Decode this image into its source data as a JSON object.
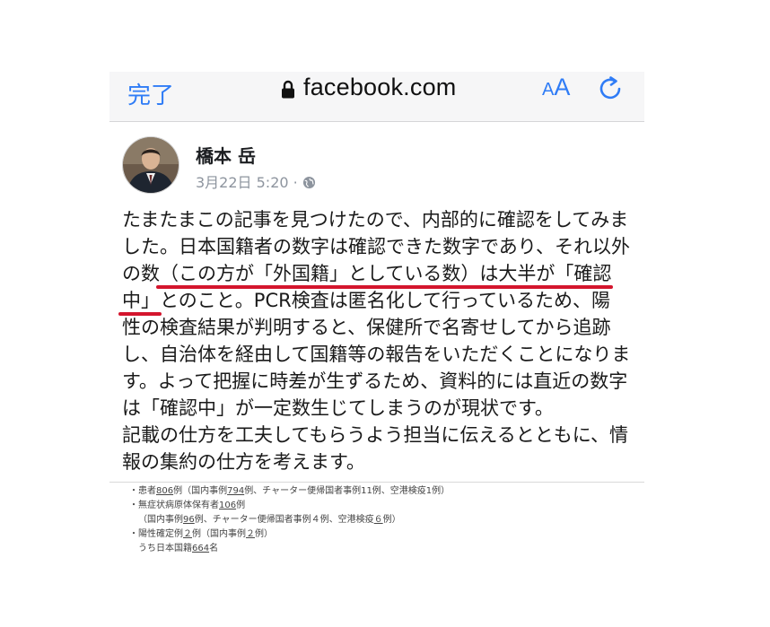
{
  "browser": {
    "done_label": "完了",
    "url": "facebook.com",
    "text_size_small": "A",
    "text_size_big": "A",
    "icons": [
      "lock-icon",
      "reload-icon"
    ],
    "accent_color": "#2f7cf6"
  },
  "post": {
    "author": "橋本 岳",
    "timestamp": "3月22日 5:20",
    "separator": "·",
    "visibility_icon": "globe-icon",
    "lines": [
      [
        "たまたまこの記事を見つけたので、内部的に確認をしてみま"
      ],
      [
        "した。日本国籍者の数字は確認できた数字であり、それ以外"
      ],
      [
        "の数",
        "（この方が「外国籍」としている数）は大半が「確認"
      ],
      [
        "中」",
        "とのこと。PCR検査は匿名化して行っているため、陽"
      ],
      [
        "性の検査結果が判明すると、保健所で名寄せしてから追跡"
      ],
      [
        "し、自治体を経由して国籍等の報告をいただくことになりま"
      ],
      [
        "す。よって把握に時差が生ずるため、資料的には直近の数字"
      ],
      [
        "は「確認中」が一定数生じてしまうのが現状です。"
      ],
      [
        "記載の仕方を工夫してもらうよう担当に伝えるとともに、情"
      ],
      [
        "報の集約の仕方を考えます。"
      ]
    ],
    "underline_color": "#d4152d"
  },
  "snippet": {
    "rows": [
      {
        "pre": "・患者",
        "u": "806",
        "post": "例（国内事例",
        "u2": "794",
        "post2": "例、チャーター便帰国者事例11例、空港検疫1例）"
      },
      {
        "pre": "・無症状病原体保有者",
        "u": "106",
        "post": "例",
        "u2": "",
        "post2": ""
      },
      {
        "pre": "（国内事例",
        "u": "96",
        "post": "例、チャーター便帰国者事例４例、空港検疫",
        "u2": "６",
        "post2": "例）"
      },
      {
        "pre": "・陽性確定例",
        "u": "２",
        "post": "例（国内事例",
        "u2": "２",
        "post2": "例）"
      },
      {
        "pre": "うち日本国籍",
        "u": "664",
        "post": "名",
        "u2": "",
        "post2": ""
      }
    ]
  }
}
